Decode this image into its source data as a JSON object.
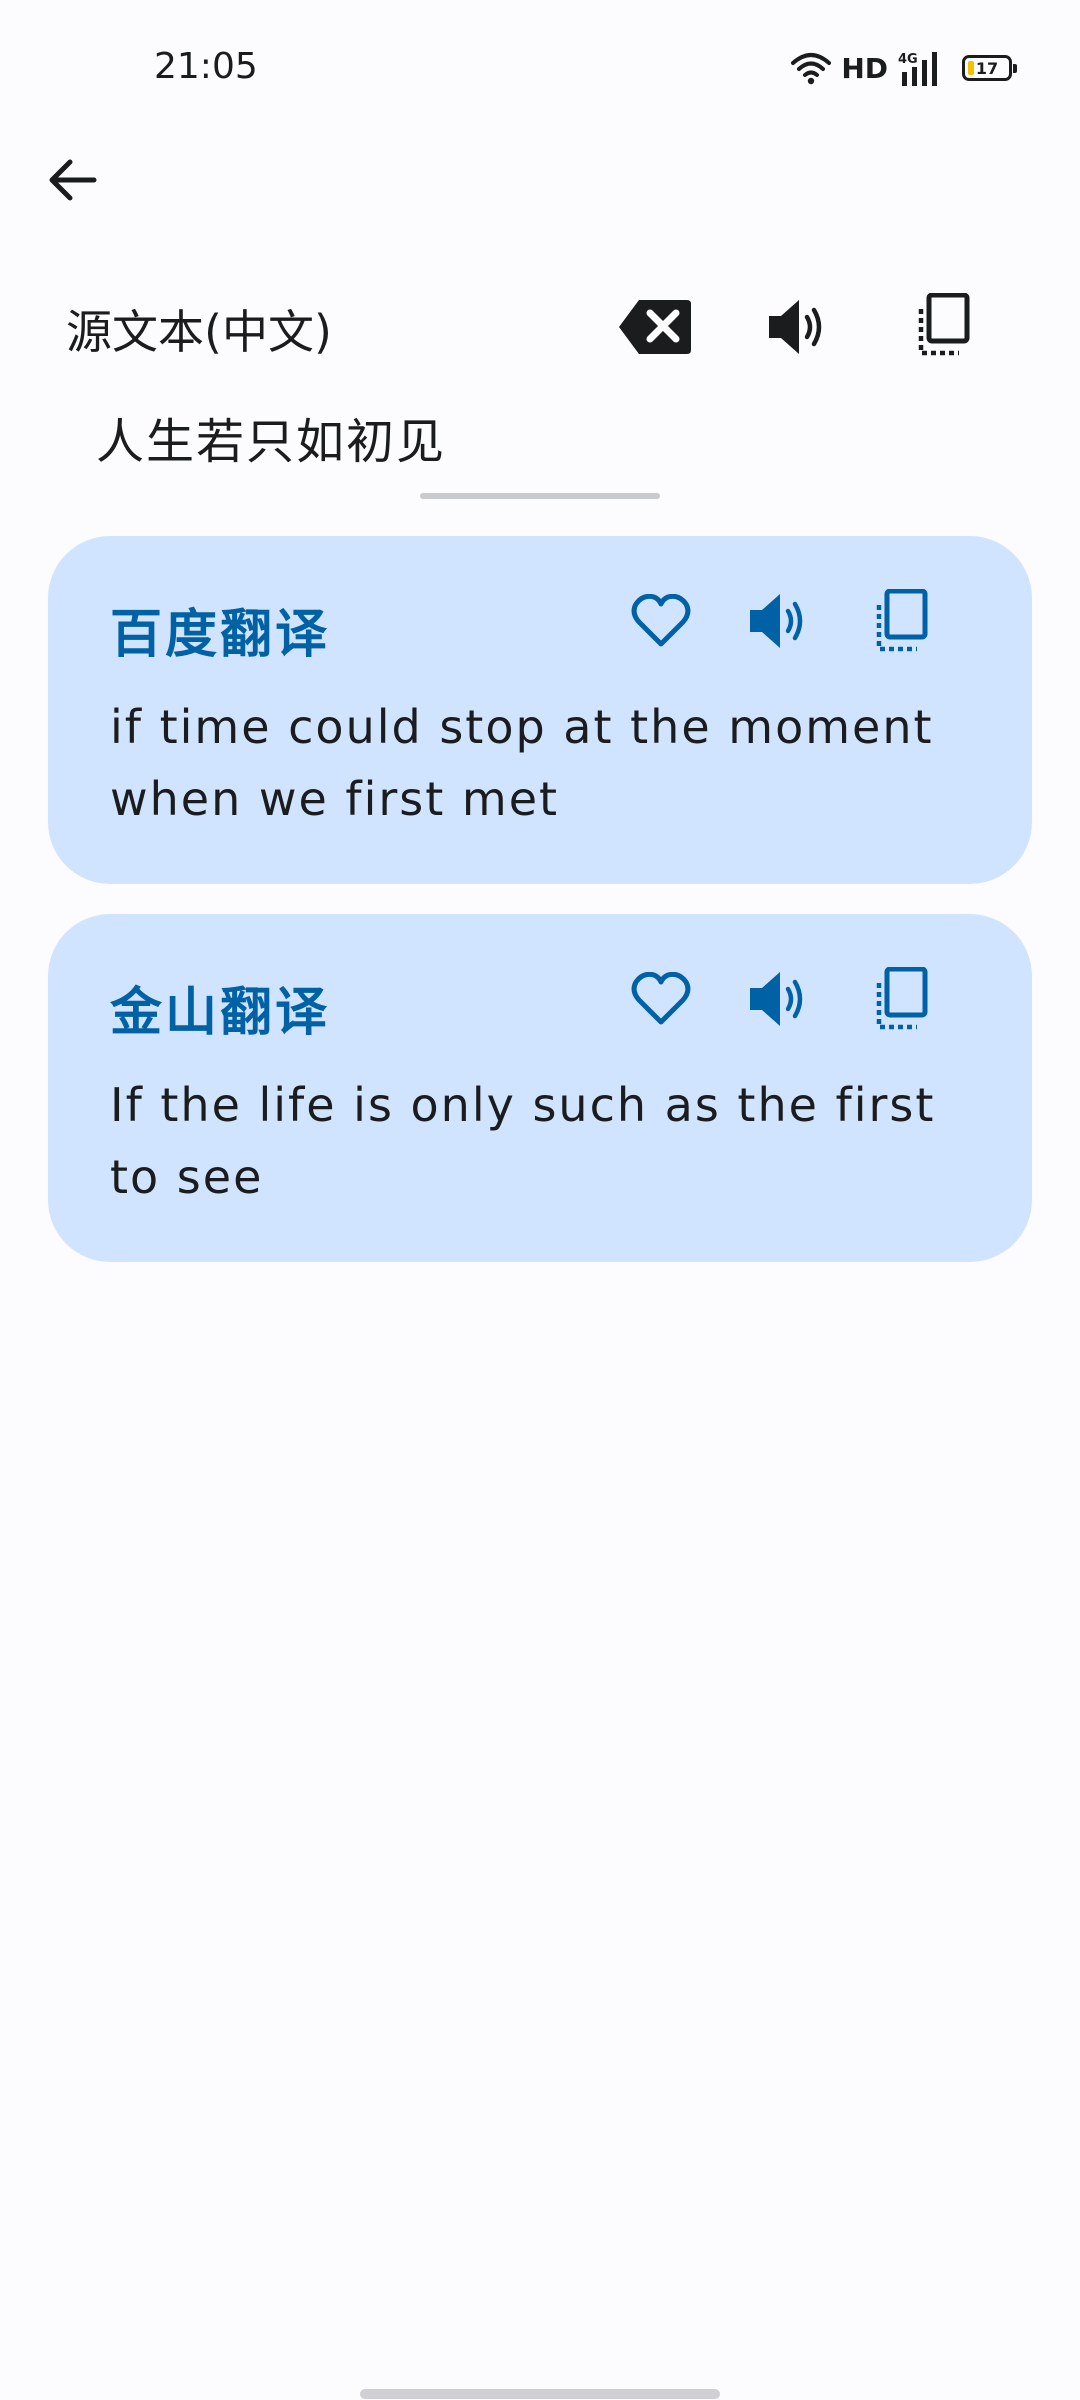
{
  "status_bar": {
    "time": "21:05",
    "network_label": "HD",
    "signal_label": "4G",
    "battery_level": "17",
    "battery_fraction": 0.17
  },
  "toolbar": {
    "back_icon": "arrow-back-icon"
  },
  "source": {
    "label": "源文本(中文)",
    "text": "人生若只如初见",
    "clear_icon": "backspace-icon",
    "speak_icon": "volume-icon",
    "copy_icon": "copy-icon"
  },
  "results": [
    {
      "title": "百度翻译",
      "text": "if time could stop at the moment when we first met",
      "favorite_icon": "heart-icon",
      "speak_icon": "volume-icon",
      "copy_icon": "copy-icon"
    },
    {
      "title": "金山翻译",
      "text": "If the life is only such as the first to see",
      "favorite_icon": "heart-icon",
      "speak_icon": "volume-icon",
      "copy_icon": "copy-icon"
    }
  ],
  "colors": {
    "background": "#fcfcff",
    "card_background": "#d1e4ff",
    "accent": "#0061a4",
    "text": "#1a1c1e",
    "battery_fill": "#f2c200"
  }
}
